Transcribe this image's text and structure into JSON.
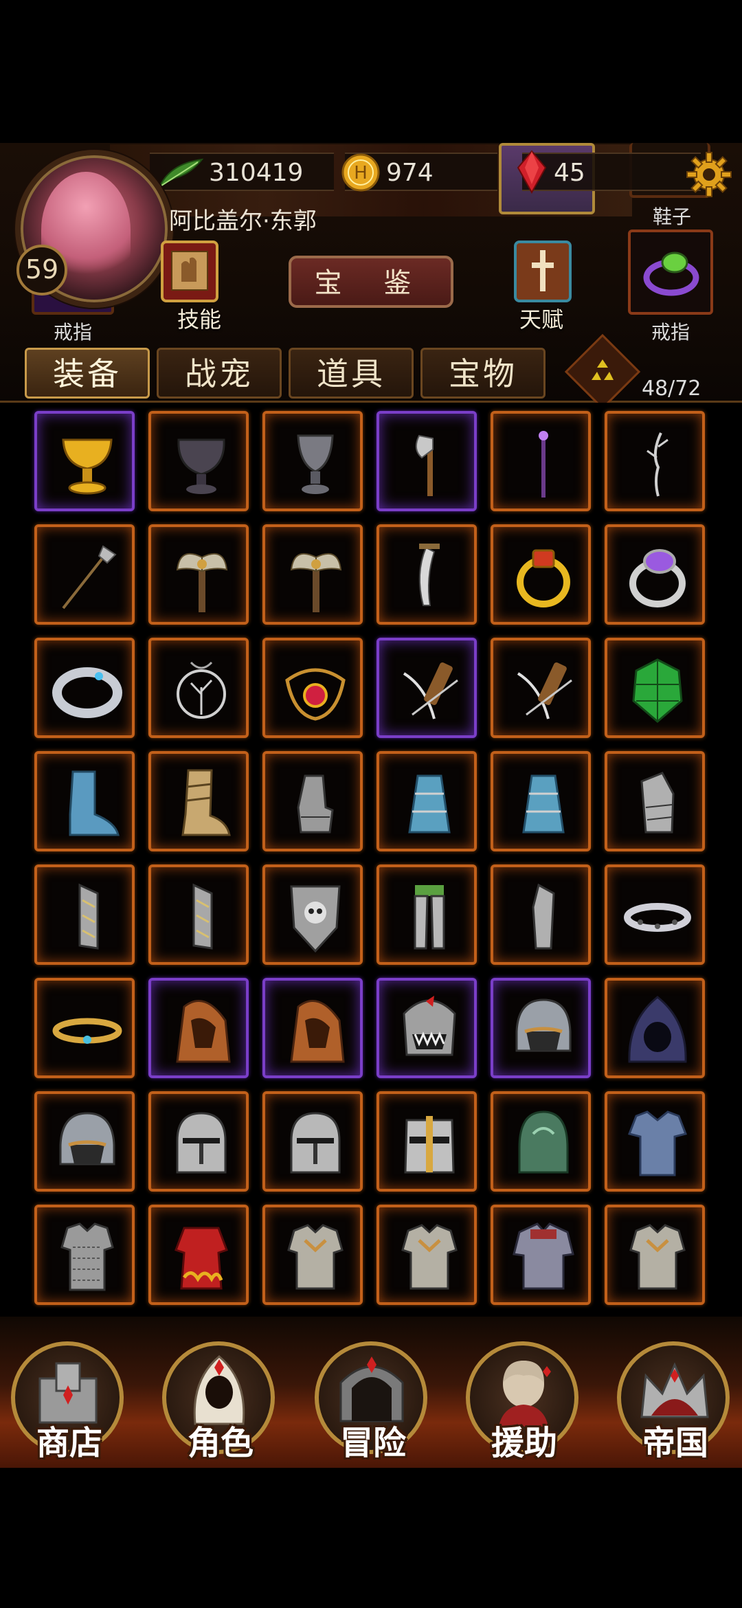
{
  "player": {
    "name": "阿比盖尔·东郭",
    "level": "59"
  },
  "resources": {
    "exp": "310419",
    "gold": "974",
    "gems": "45"
  },
  "equipped": {
    "ring_left_label": "戒指",
    "ring_right_label": "戒指",
    "shoes_label": "鞋子"
  },
  "actions": {
    "skill_label": "技能",
    "talent_label": "天赋",
    "treasure_book_label": "宝 鉴"
  },
  "tabs": [
    {
      "label": "装备",
      "active": true
    },
    {
      "label": "战宠",
      "active": false
    },
    {
      "label": "道具",
      "active": false
    },
    {
      "label": "宝物",
      "active": false
    }
  ],
  "inventory": {
    "capacity": "48/72",
    "items": [
      {
        "icon": "golden-chalice-icon",
        "rarity": "purple"
      },
      {
        "icon": "dark-urn-icon",
        "rarity": "orange"
      },
      {
        "icon": "grey-vase-icon",
        "rarity": "orange"
      },
      {
        "icon": "hand-axe-icon",
        "rarity": "purple"
      },
      {
        "icon": "purple-staff-icon",
        "rarity": "orange"
      },
      {
        "icon": "twig-wand-icon",
        "rarity": "orange"
      },
      {
        "icon": "halberd-icon",
        "rarity": "orange"
      },
      {
        "icon": "double-axe-icon",
        "rarity": "orange"
      },
      {
        "icon": "double-axe-icon",
        "rarity": "orange"
      },
      {
        "icon": "curved-dagger-icon",
        "rarity": "orange"
      },
      {
        "icon": "ruby-gold-ring-icon",
        "rarity": "orange"
      },
      {
        "icon": "amethyst-ring-icon",
        "rarity": "orange"
      },
      {
        "icon": "silver-ring-icon",
        "rarity": "orange"
      },
      {
        "icon": "tree-amulet-icon",
        "rarity": "orange"
      },
      {
        "icon": "ruby-amulet-icon",
        "rarity": "orange"
      },
      {
        "icon": "bow-quiver-icon",
        "rarity": "purple"
      },
      {
        "icon": "bow-quiver-icon",
        "rarity": "orange"
      },
      {
        "icon": "green-shell-icon",
        "rarity": "orange"
      },
      {
        "icon": "blue-boot-icon",
        "rarity": "orange"
      },
      {
        "icon": "wrapped-boot-icon",
        "rarity": "orange"
      },
      {
        "icon": "gauntlet-icon",
        "rarity": "orange"
      },
      {
        "icon": "blue-skirt-icon",
        "rarity": "orange"
      },
      {
        "icon": "blue-skirt-icon",
        "rarity": "orange"
      },
      {
        "icon": "plate-gauntlet-icon",
        "rarity": "orange"
      },
      {
        "icon": "bracer-icon",
        "rarity": "orange"
      },
      {
        "icon": "bracer-icon",
        "rarity": "orange"
      },
      {
        "icon": "skull-shield-icon",
        "rarity": "orange"
      },
      {
        "icon": "leg-armor-icon",
        "rarity": "orange"
      },
      {
        "icon": "greave-icon",
        "rarity": "orange"
      },
      {
        "icon": "silver-bracelet-icon",
        "rarity": "orange"
      },
      {
        "icon": "gold-circlet-icon",
        "rarity": "orange"
      },
      {
        "icon": "leather-hood-icon",
        "rarity": "purple"
      },
      {
        "icon": "leather-hood-icon",
        "rarity": "purple"
      },
      {
        "icon": "fanged-helm-icon",
        "rarity": "purple"
      },
      {
        "icon": "iron-helm-icon",
        "rarity": "purple"
      },
      {
        "icon": "dark-hood-icon",
        "rarity": "orange"
      },
      {
        "icon": "iron-helm-icon",
        "rarity": "orange"
      },
      {
        "icon": "knight-helm-icon",
        "rarity": "orange"
      },
      {
        "icon": "knight-helm-icon",
        "rarity": "orange"
      },
      {
        "icon": "crusader-helm-icon",
        "rarity": "orange"
      },
      {
        "icon": "green-helm-icon",
        "rarity": "orange"
      },
      {
        "icon": "blue-tunic-icon",
        "rarity": "orange"
      },
      {
        "icon": "chainmail-icon",
        "rarity": "orange"
      },
      {
        "icon": "red-robe-icon",
        "rarity": "orange"
      },
      {
        "icon": "plate-armor-icon",
        "rarity": "orange"
      },
      {
        "icon": "plate-armor-icon",
        "rarity": "orange"
      },
      {
        "icon": "heavy-armor-icon",
        "rarity": "orange"
      },
      {
        "icon": "plate-armor-icon",
        "rarity": "orange"
      }
    ]
  },
  "nav": [
    {
      "label": "商店",
      "icon": "castle-icon"
    },
    {
      "label": "角色",
      "icon": "hooded-figure-icon"
    },
    {
      "label": "冒险",
      "icon": "dungeon-gate-icon"
    },
    {
      "label": "援助",
      "icon": "companion-icon"
    },
    {
      "label": "帝国",
      "icon": "crown-icon"
    }
  ],
  "colors": {
    "rarity_orange": "#c2601a",
    "rarity_purple": "#7a3ec8",
    "accent_gold": "#c89a4a"
  }
}
